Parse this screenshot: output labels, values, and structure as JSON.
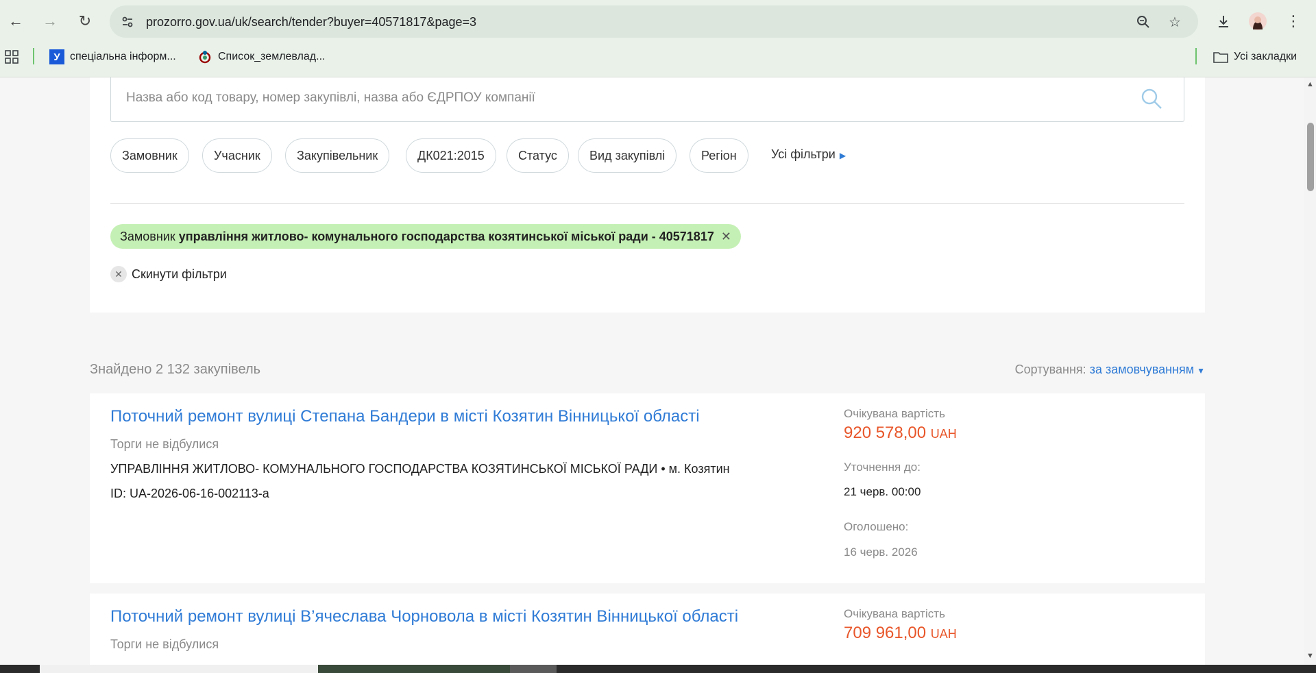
{
  "browser": {
    "url": "prozorro.gov.ua/uk/search/tender?buyer=40571817&page=3",
    "bookmarks": [
      {
        "label": "спеціальна інформ...",
        "icon": "y-icon"
      },
      {
        "label": "Список_землевлад...",
        "icon": "wikimedia-icon"
      }
    ],
    "all_bookmarks": "Усі закладки"
  },
  "search": {
    "placeholder": "Назва або код товару, номер закупівлі, назва або ЄДРПОУ компанії"
  },
  "filters": {
    "chips": [
      "Замовник",
      "Учасник",
      "Закупівельник",
      "ДК021:2015",
      "Статус",
      "Вид закупівлі",
      "Регіон"
    ],
    "all_filters": "Усі фільтри",
    "active": {
      "prefix": "Замовник",
      "value": "управління житлово- комунального господарства козятинської міської ради - 40571817"
    },
    "reset": "Скинути фільтри"
  },
  "results": {
    "found": "Знайдено 2 132 закупівель",
    "sort_label": "Сортування:",
    "sort_value": "за замовчуванням"
  },
  "tenders": [
    {
      "title": "Поточний ремонт вулиці Степана Бандери в місті Козятин Вінницької області",
      "status": "Торги не відбулися",
      "buyer": "УПРАВЛІННЯ ЖИТЛОВО- КОМУНАЛЬНОГО ГОСПОДАРСТВА КОЗЯТИНСЬКОЇ МІСЬКОЇ РАДИ • м. Козятин",
      "id": "ID: UA-2026-06-16-002113-a",
      "expected_label": "Очікувана вартість",
      "amount": "920 578,00",
      "currency": "UAH",
      "clarify_label": "Уточнення до:",
      "clarify_date": "21 черв. 00:00",
      "announced_label": "Оголошено:",
      "announced_date": "16 черв. 2026"
    },
    {
      "title": "Поточний ремонт вулиці В’ячеслава Чорновола в місті Козятин Вінницької області",
      "status": "Торги не відбулися",
      "expected_label": "Очікувана вартість",
      "amount": "709 961,00",
      "currency": "UAH"
    }
  ],
  "colors": {
    "link": "#2f7bd6",
    "amount": "#e8562a",
    "active_chip": "#c5f0b5"
  }
}
